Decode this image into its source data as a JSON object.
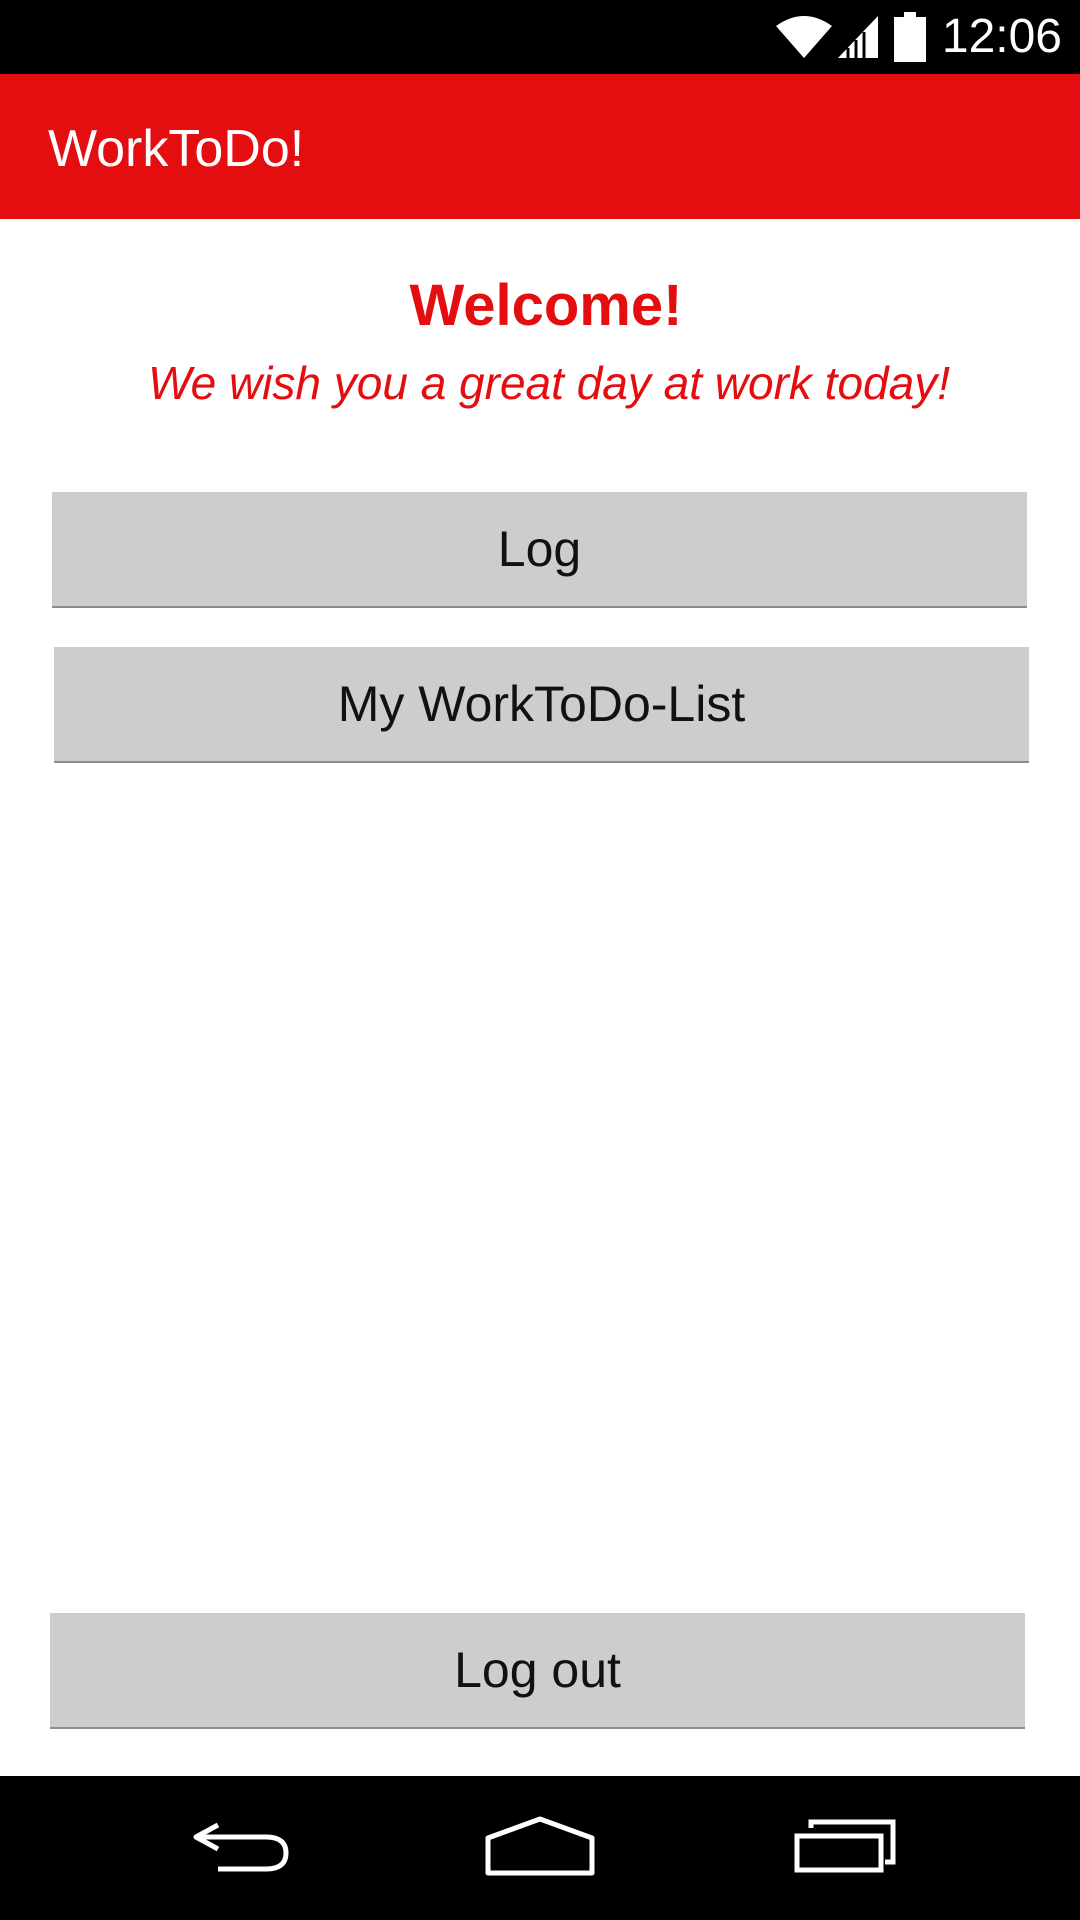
{
  "status_bar": {
    "time": "12:06",
    "icons": [
      "wifi-icon",
      "signal-icon",
      "battery-icon"
    ]
  },
  "app_bar": {
    "title": "WorkToDo!"
  },
  "welcome": {
    "title": "Welcome!",
    "subtitle": "We wish you a great day at work today!"
  },
  "buttons": {
    "log": "Log",
    "list": "My WorkToDo-List",
    "logout": "Log out"
  },
  "nav_bar": {
    "icons": [
      "back-icon",
      "home-icon",
      "recent-apps-icon"
    ]
  },
  "colors": {
    "accent": "#e40d10",
    "button_bg": "#cdcdcd",
    "bars": "#000000"
  }
}
